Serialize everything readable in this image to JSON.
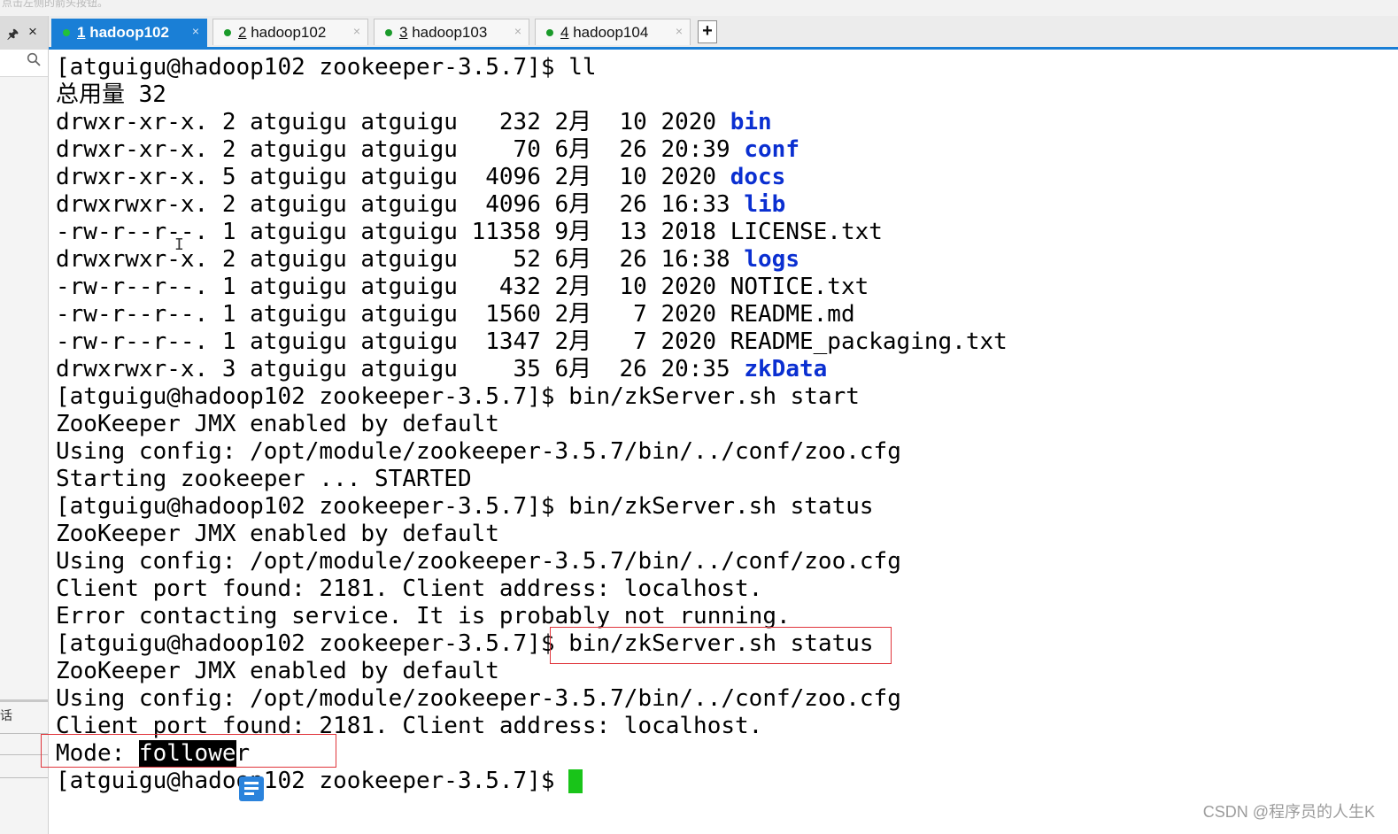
{
  "top_text": "点击左侧的箭头按钮。",
  "left_panel": {
    "pin_icon": "pin-icon",
    "close_glyph": "×",
    "search_icon": "search-icon",
    "char": "话"
  },
  "tabs": [
    {
      "num": "1",
      "name": "hadoop102",
      "active": true,
      "close": "×"
    },
    {
      "num": "2",
      "name": "hadoop102",
      "active": false,
      "close": "×"
    },
    {
      "num": "3",
      "name": "hadoop103",
      "active": false,
      "close": "×"
    },
    {
      "num": "4",
      "name": "hadoop104",
      "active": false,
      "close": "×"
    }
  ],
  "add_tab_label": "+",
  "prompt": "[atguigu@hadoop102 zookeeper-3.5.7]$ ",
  "terminal": {
    "l0": "ll",
    "l1": "总用量 32",
    "ls": [
      {
        "pre": "drwxr-xr-x. 2 atguigu atguigu   232 2月  10 2020 ",
        "name": "bin",
        "dir": true
      },
      {
        "pre": "drwxr-xr-x. 2 atguigu atguigu    70 6月  26 20:39 ",
        "name": "conf",
        "dir": true
      },
      {
        "pre": "drwxr-xr-x. 5 atguigu atguigu  4096 2月  10 2020 ",
        "name": "docs",
        "dir": true
      },
      {
        "pre": "drwxrwxr-x. 2 atguigu atguigu  4096 6月  26 16:33 ",
        "name": "lib",
        "dir": true
      },
      {
        "pre": "-rw-r--r--. 1 atguigu atguigu 11358 9月  13 2018 ",
        "name": "LICENSE.txt",
        "dir": false
      },
      {
        "pre": "drwxrwxr-x. 2 atguigu atguigu    52 6月  26 16:38 ",
        "name": "logs",
        "dir": true
      },
      {
        "pre": "-rw-r--r--. 1 atguigu atguigu   432 2月  10 2020 ",
        "name": "NOTICE.txt",
        "dir": false
      },
      {
        "pre": "-rw-r--r--. 1 atguigu atguigu  1560 2月   7 2020 ",
        "name": "README.md",
        "dir": false
      },
      {
        "pre": "-rw-r--r--. 1 atguigu atguigu  1347 2月   7 2020 ",
        "name": "README_packaging.txt",
        "dir": false
      },
      {
        "pre": "drwxrwxr-x. 3 atguigu atguigu    35 6月  26 20:35 ",
        "name": "zkData",
        "dir": true
      }
    ],
    "cmd_start": "bin/zkServer.sh start",
    "jmx": "ZooKeeper JMX enabled by default",
    "config": "Using config: /opt/module/zookeeper-3.5.7/bin/../conf/zoo.cfg",
    "started": "Starting zookeeper ... STARTED",
    "cmd_status": "bin/zkServer.sh status",
    "client_port": "Client port found: 2181. Client address: localhost.",
    "error": "Error contacting service. It is probably not running.",
    "mode_label": "Mode: ",
    "mode_hl": "followe",
    "mode_rest": "r"
  },
  "watermark": "CSDN @程序员的人生K"
}
